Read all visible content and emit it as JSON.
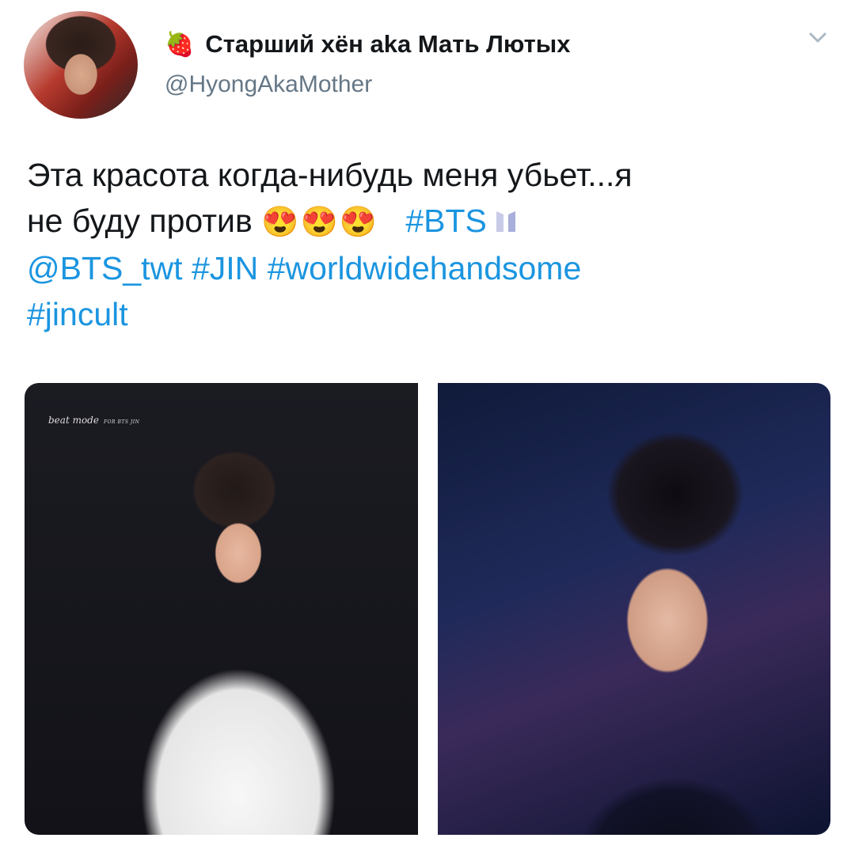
{
  "tweet": {
    "author": {
      "display_name": "Старший хён aka Мать Лютых",
      "name_emoji": "🍓",
      "handle": "@HyongAkaMother",
      "avatar_icon": "profile-photo"
    },
    "text": {
      "line1": "Эта красота когда-нибудь меня убьет...я",
      "line2_text": "не буду против",
      "emojis": "😍😍😍",
      "hashtag_bts": "#BTS",
      "mention": "@BTS_twt",
      "hashtag_jin": "#JIN",
      "hashtag_wwh": "#worldwidehandsome",
      "hashtag_jincult": "#jincult"
    },
    "media": {
      "left_watermark": "beat mode",
      "left_watermark_small": "FOR BTS JIN"
    }
  },
  "colors": {
    "link": "#1b95e0",
    "secondary_text": "#657786",
    "primary_text": "#14171a"
  }
}
